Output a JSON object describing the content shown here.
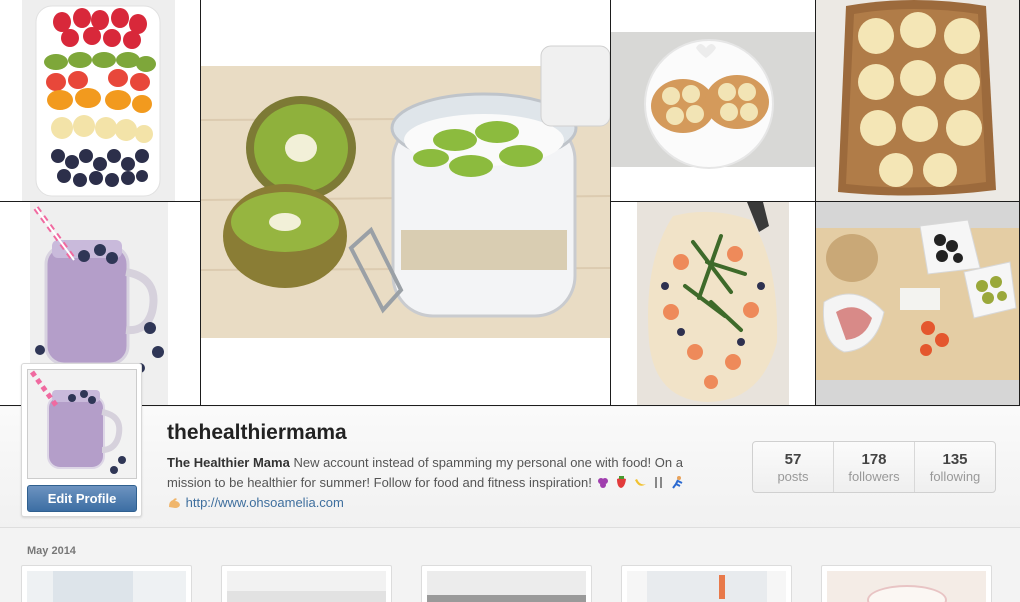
{
  "profile": {
    "username": "thehealthiermama",
    "full_name": "The Healthier Mama",
    "bio": "New account instead of spamming my personal one with food! On a mission to be healthier for summer! Follow for food and fitness inspiration!",
    "website": "http://www.ohsoamelia.com",
    "edit_profile_label": "Edit Profile"
  },
  "stats": [
    {
      "count": "57",
      "label": "posts"
    },
    {
      "count": "178",
      "label": "followers"
    },
    {
      "count": "135",
      "label": "following"
    }
  ],
  "cover_photos": [
    {
      "subject": "fruit box with strawberries, kiwi, orange, banana and blueberries"
    },
    {
      "subject": "kiwi slices on yogurt in a glass jar"
    },
    {
      "subject": "banana slices on bagel halves"
    },
    {
      "subject": "banana slices on toast"
    },
    {
      "subject": "blueberry smoothie in a mason jar"
    },
    {
      "subject": "shrimp pizza with rocket"
    },
    {
      "subject": "bread roll, olives and ham platter"
    }
  ],
  "feed": {
    "month_label": "May 2014",
    "thumbnail_count": 5
  },
  "colors": {
    "accent": "#3c6ea3",
    "link": "#3f6f9e",
    "background": "#f3f3f3"
  }
}
